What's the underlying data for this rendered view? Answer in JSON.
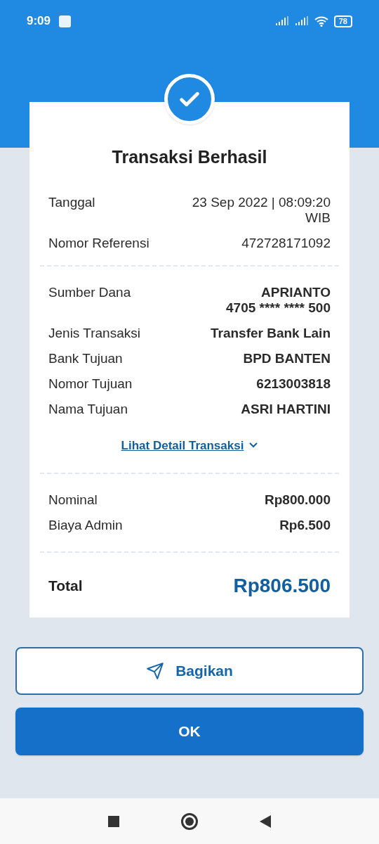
{
  "status_bar": {
    "time": "9:09",
    "battery": "78"
  },
  "receipt": {
    "title": "Transaksi Berhasil",
    "sections": [
      {
        "rows": [
          {
            "label": "Tanggal",
            "value": [
              "23 Sep 2022 | 08:09:20 WIB"
            ],
            "bold": false
          },
          {
            "label": "Nomor Referensi",
            "value": [
              "472728171092"
            ],
            "bold": false
          }
        ]
      },
      {
        "rows": [
          {
            "label": "Sumber Dana",
            "value": [
              "APRIANTO",
              "4705 **** **** 500"
            ],
            "bold": true
          },
          {
            "label": "Jenis Transaksi",
            "value": [
              "Transfer Bank Lain"
            ],
            "bold": true
          },
          {
            "label": "Bank Tujuan",
            "value": [
              "BPD BANTEN"
            ],
            "bold": true
          },
          {
            "label": "Nomor Tujuan",
            "value": [
              "6213003818"
            ],
            "bold": true
          },
          {
            "label": "Nama Tujuan",
            "value": [
              "ASRI HARTINI"
            ],
            "bold": true
          }
        ],
        "link": "Lihat Detail Transaksi"
      },
      {
        "rows": [
          {
            "label": "Nominal",
            "value": [
              "Rp800.000"
            ],
            "bold": true
          },
          {
            "label": "Biaya Admin",
            "value": [
              "Rp6.500"
            ],
            "bold": true
          }
        ]
      }
    ],
    "total": {
      "label": "Total",
      "value": "Rp806.500"
    }
  },
  "buttons": [
    {
      "label": "Bagikan",
      "kind": "outline"
    },
    {
      "label": "OK",
      "kind": "filled"
    }
  ]
}
